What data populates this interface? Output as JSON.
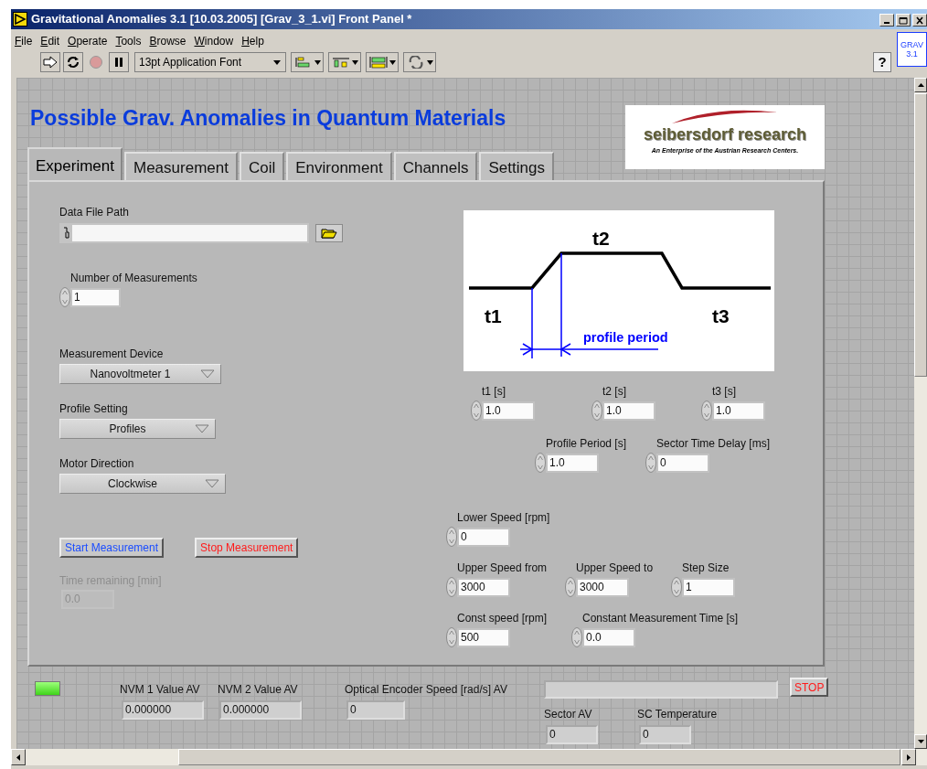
{
  "window": {
    "title": "Gravitational Anomalies 3.1 [10.03.2005] [Grav_3_1.vi] Front Panel *"
  },
  "menu": [
    {
      "label": "File"
    },
    {
      "label": "Edit"
    },
    {
      "label": "Operate"
    },
    {
      "label": "Tools"
    },
    {
      "label": "Browse"
    },
    {
      "label": "Window"
    },
    {
      "label": "Help"
    }
  ],
  "toolbar": {
    "font": "13pt Application Font",
    "help": "?"
  },
  "vi_icon": [
    "GRAV",
    "3.1"
  ],
  "heading": "Possible Grav. Anomalies in Quantum Materials",
  "logo": {
    "name": "seibersdorf research",
    "tagline": "An Enterprise of the Austrian Research Centers."
  },
  "tabs": [
    {
      "label": "Experiment",
      "selected": true
    },
    {
      "label": "Measurement",
      "selected": false
    },
    {
      "label": "Coil",
      "selected": false
    },
    {
      "label": "Environment",
      "selected": false
    },
    {
      "label": "Channels",
      "selected": false
    },
    {
      "label": "Settings",
      "selected": false
    }
  ],
  "experiment": {
    "data_file_path": {
      "label": "Data File Path"
    },
    "measurements": {
      "label": "Number of Measurements",
      "value": "1"
    },
    "rings": [
      {
        "label": "Measurement Device",
        "value": "Nanovoltmeter 1"
      },
      {
        "label": "Profile Setting",
        "value": "Profiles"
      },
      {
        "label": "Motor Direction",
        "value": "Clockwise"
      }
    ],
    "buttons": [
      {
        "label": "Start Measurement",
        "kind": "start"
      },
      {
        "label": "Stop Measurement",
        "kind": "stop"
      }
    ],
    "time_remaining": {
      "label": "Time remaining [min]",
      "value": "0.0",
      "disabled": true
    },
    "diagram": {
      "labels": [
        "t1",
        "t2",
        "t3"
      ],
      "period": "profile period"
    },
    "timing_rows": [
      [
        {
          "label": "t1 [s]",
          "value": "1.0"
        },
        {
          "label": "t2 [s]",
          "value": "1.0"
        },
        {
          "label": "t3 [s]",
          "value": "1.0"
        }
      ],
      [
        {
          "label": "Profile Period [s]",
          "value": "1.0"
        },
        {
          "label": "Sector Time Delay [ms]",
          "value": "0"
        }
      ],
      [
        {
          "label": "Lower Speed [rpm]",
          "value": "0"
        }
      ],
      [
        {
          "label": "Upper Speed from",
          "value": "3000"
        },
        {
          "label": "Upper Speed to",
          "value": "3000"
        },
        {
          "label": "Step Size",
          "value": "1"
        }
      ],
      [
        {
          "label": "Const speed [rpm]",
          "value": "500"
        },
        {
          "label": "Constant Measurement Time [s]",
          "value": "0.0"
        }
      ]
    ]
  },
  "status": {
    "led_on": true,
    "indicators": [
      {
        "label": "NVM 1 Value AV",
        "value": "0.000000"
      },
      {
        "label": "NVM 2 Value AV",
        "value": "0.000000"
      },
      {
        "label": "Optical Encoder Speed [rad/s] AV",
        "value": "0"
      }
    ],
    "stop_button": "STOP",
    "lower_indicators": [
      {
        "label": "Sector AV",
        "value": "0"
      },
      {
        "label": "SC Temperature",
        "value": "0"
      }
    ]
  }
}
